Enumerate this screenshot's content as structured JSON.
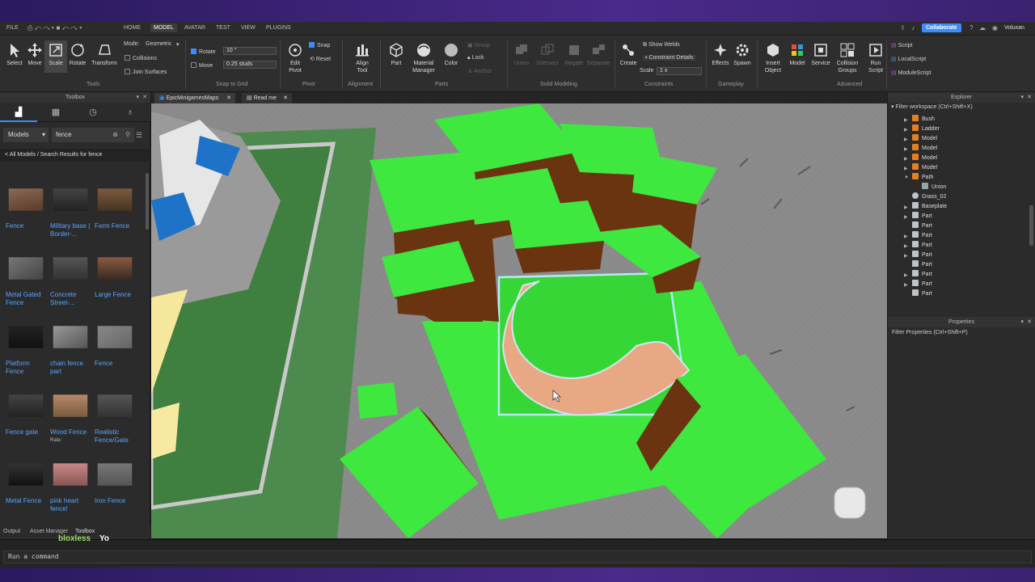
{
  "menubar": {
    "file": "FILE",
    "home": "HOME",
    "model": "MODEL",
    "avatar": "AVATAR",
    "test": "TEST",
    "view": "VIEW",
    "plugins": "PLUGINS",
    "collaborate": "Collaborate",
    "user": "Voluxan"
  },
  "ribbon": {
    "select": "Select",
    "move": "Move",
    "scale": "Scale",
    "rotate": "Rotate",
    "transform": "Transform",
    "mode_label": "Mode:",
    "mode_value": "Geometric",
    "collisions": "Collisions",
    "join_surfaces": "Join Surfaces",
    "tools_group": "Tools",
    "rotate_opt": "Rotate",
    "rotate_value": "10 °",
    "move_opt": "Move",
    "move_value": "0.25 studs",
    "snap_group": "Snap to Grid",
    "edit_pivot": "Edit\nPivot",
    "snap": "Snap",
    "reset": "Reset",
    "pivot_group": "Pivot",
    "align_tool": "Align\nTool",
    "alignment_group": "Alignment",
    "part": "Part",
    "material_manager": "Material\nManager",
    "color": "Color",
    "group": "Group",
    "lock": "Lock",
    "anchor": "Anchor",
    "parts_group": "Parts",
    "union": "Union",
    "intersect": "Intersect",
    "negate": "Negate",
    "separate": "Separate",
    "solid_group": "Solid Modeling",
    "create": "Create",
    "show_welds": "Show Welds",
    "constraint_details": "Constraint Details",
    "scale_label": "Scale",
    "scale_value": "1 x",
    "constraints_group": "Constraints",
    "effects": "Effects",
    "spawn": "Spawn",
    "gameplay_group": "Gameplay",
    "insert_object": "Insert\nObject",
    "model": "Model",
    "service": "Service",
    "collision_groups": "Collision\nGroups",
    "run_script": "Run\nScript",
    "advanced_group": "Advanced",
    "script": "Script",
    "local_script": "LocalScript",
    "module_script": "ModuleScript"
  },
  "toolbox": {
    "title": "Toolbox",
    "category": "Models",
    "search_value": "fence",
    "breadcrumb": "< All Models / Search Results for fence",
    "items": [
      {
        "name": "Fence"
      },
      {
        "name": "Military base | Border-..."
      },
      {
        "name": "Farm Fence"
      },
      {
        "name": "Metal Gated Fence"
      },
      {
        "name": "Concrete Street-..."
      },
      {
        "name": "Large Fence"
      },
      {
        "name": "Platform Fence"
      },
      {
        "name": "chain fence part"
      },
      {
        "name": "Fence"
      },
      {
        "name": "Fence gate"
      },
      {
        "name": "Wood Fence"
      },
      {
        "name": "Realistic Fence/Gate"
      },
      {
        "name": "Metal Fence"
      },
      {
        "name": "pink heart fence!"
      },
      {
        "name": "Iron Fence"
      }
    ],
    "rate_label": "Rate:"
  },
  "doc_tabs": {
    "tab1": "EpicMinigamesMaps",
    "tab2": "Read me"
  },
  "explorer": {
    "title": "Explorer",
    "filter": "Filter workspace (Ctrl+Shift+X)",
    "rows": [
      {
        "label": "Bush",
        "icon": "model-icon"
      },
      {
        "label": "Ladder",
        "icon": "model-icon"
      },
      {
        "label": "Model",
        "icon": "model-icon"
      },
      {
        "label": "Model",
        "icon": "model-icon"
      },
      {
        "label": "Model",
        "icon": "model-icon"
      },
      {
        "label": "Model",
        "icon": "model-icon"
      },
      {
        "label": "Path",
        "icon": "model-icon"
      },
      {
        "label": "Union",
        "icon": "union-icon"
      },
      {
        "label": "Grass_02",
        "icon": "mesh-icon"
      },
      {
        "label": "Baseplate",
        "icon": "part-icon"
      },
      {
        "label": "Part",
        "icon": "part-icon"
      },
      {
        "label": "Part",
        "icon": "part-icon"
      },
      {
        "label": "Part",
        "icon": "part-icon"
      },
      {
        "label": "Part",
        "icon": "part-icon"
      },
      {
        "label": "Part",
        "icon": "part-icon"
      },
      {
        "label": "Part",
        "icon": "part-icon"
      },
      {
        "label": "Part",
        "icon": "part-icon"
      },
      {
        "label": "Part",
        "icon": "part-icon"
      },
      {
        "label": "Part",
        "icon": "part-icon"
      }
    ]
  },
  "properties": {
    "title": "Properties",
    "filter": "Filter Properties (Ctrl+Shift+P)"
  },
  "bottom_tabs": {
    "output": "Output",
    "asset_manager": "Asset Manager",
    "toolbox": "Toolbox"
  },
  "command": {
    "placeholder": "Run a command"
  },
  "chat": {
    "user": "bloxless",
    "message": "Yo"
  },
  "colors": {
    "accent": "#3d8bfd",
    "grass": "#3ee83e",
    "dirt": "#6b3410",
    "path": "#e8a884"
  }
}
